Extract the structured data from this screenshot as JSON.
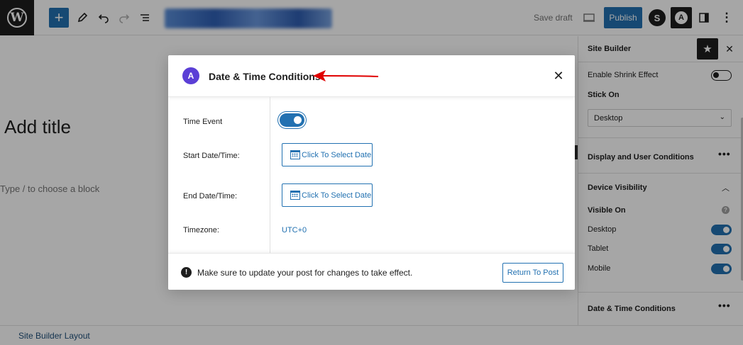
{
  "toolbar": {
    "save_draft": "Save draft",
    "publish": "Publish"
  },
  "editor": {
    "title_placeholder": "Add title",
    "block_hint": "Type / to choose a block"
  },
  "sidebar": {
    "title": "Site Builder",
    "enable_shrink": "Enable Shrink Effect",
    "stick_on_label": "Stick On",
    "stick_on_value": "Desktop",
    "display_conditions": "Display and User Conditions",
    "device_visibility": "Device Visibility",
    "visible_on": "Visible On",
    "devices": [
      {
        "label": "Desktop",
        "enabled": true
      },
      {
        "label": "Tablet",
        "enabled": true
      },
      {
        "label": "Mobile",
        "enabled": true
      }
    ],
    "date_time_conditions": "Date & Time Conditions"
  },
  "footer": {
    "layout_link": "Site Builder Layout"
  },
  "modal": {
    "title": "Date & Time Conditions",
    "time_event_label": "Time Event",
    "time_event_enabled": true,
    "start_label": "Start Date/Time:",
    "start_button": "Click To Select Date",
    "end_label": "End Date/Time:",
    "end_button": "Click To Select Date",
    "timezone_label": "Timezone:",
    "timezone_value": "UTC+0",
    "notice": "Make sure to update your post for changes to take effect.",
    "return_button": "Return To Post"
  },
  "colors": {
    "accent": "#2271b1",
    "dark": "#1e1e1e",
    "astra_brand": "#5b3fd6",
    "annotation_arrow": "#e00000"
  }
}
